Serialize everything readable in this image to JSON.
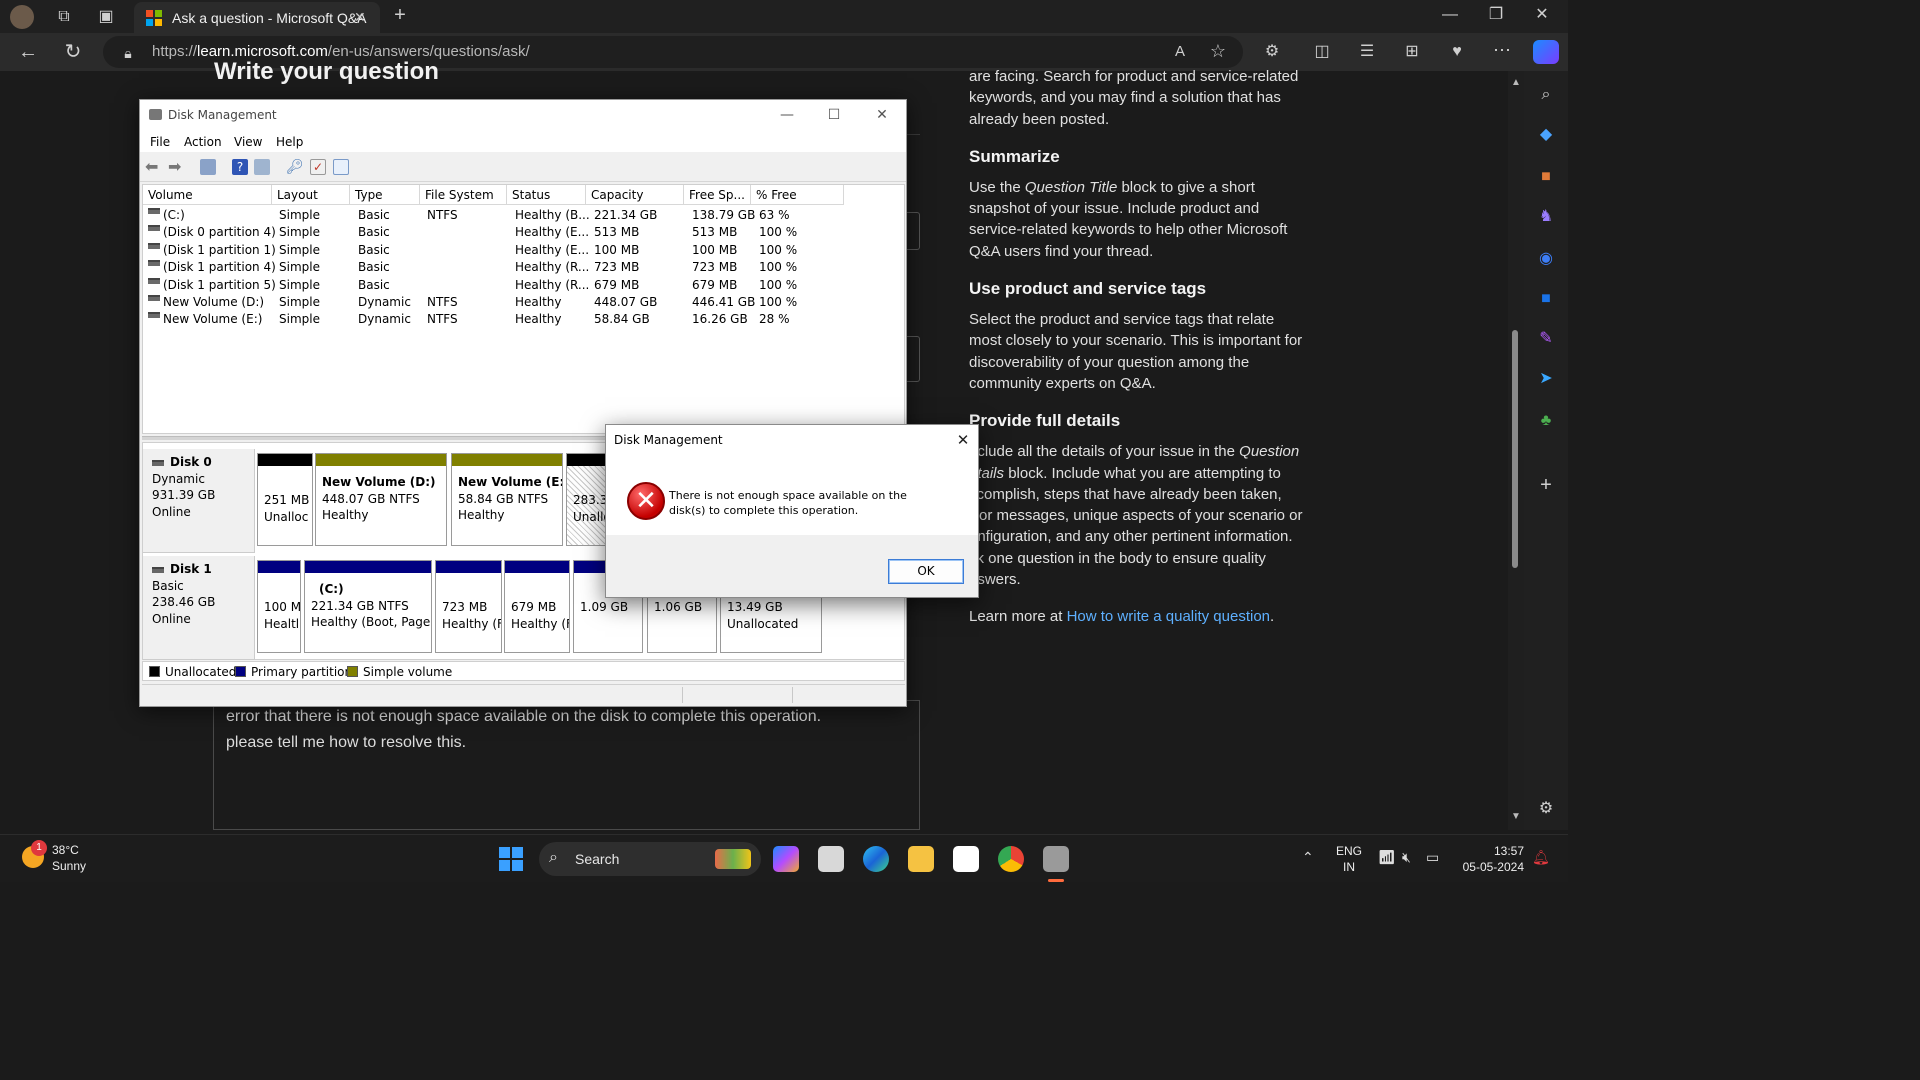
{
  "browser": {
    "tab_title": "Ask a question - Microsoft Q&A",
    "url_prefix": "https://",
    "url_domain": "learn.microsoft.com",
    "url_path": "/en-us/answers/questions/ask/"
  },
  "page": {
    "heading": "Write your question",
    "editor_text_line1": "error that there is not enough space available on the disk to complete this operation.",
    "editor_text_line2": "please tell me how to resolve this.",
    "guidance_intro": "are facing. Search for product and service-related keywords, and you may find a solution that has already been posted.",
    "summarize_heading": "Summarize",
    "summarize_pre": "Use the ",
    "summarize_em": "Question Title",
    "summarize_post": " block to give a short snapshot of your issue. Include product and service-related keywords to help other Microsoft Q&A users find your thread.",
    "tags_heading": "Use product and service tags",
    "tags_text": "Select the product and service tags that relate most closely to your scenario. This is important for discoverability of your question among the community experts on Q&A.",
    "details_heading": "Provide full details",
    "details_pre": "nclude all the details of your issue in the ",
    "details_em1": "Question",
    "details_em2": "etails",
    "details_post": " block. Include what you are attempting to ccomplish, steps that have already been taken, rror messages, unique aspects of your scenario or onfiguration, and any other pertinent information. sk one question in the body to ensure quality nswers.",
    "learn_more_pre": "Learn more at ",
    "learn_more_link": "How to write a quality question",
    "learn_more_post": "."
  },
  "disk_management": {
    "title": "Disk Management",
    "menu": [
      "File",
      "Action",
      "View",
      "Help"
    ],
    "columns": [
      "Volume",
      "Layout",
      "Type",
      "File System",
      "Status",
      "Capacity",
      "Free Sp...",
      "% Free"
    ],
    "rows": [
      [
        "(C:)",
        "Simple",
        "Basic",
        "NTFS",
        "Healthy (B...",
        "221.34 GB",
        "138.79 GB",
        "63 %"
      ],
      [
        "(Disk 0 partition 4)",
        "Simple",
        "Basic",
        "",
        "Healthy (E...",
        "513 MB",
        "513 MB",
        "100 %"
      ],
      [
        "(Disk 1 partition 1)",
        "Simple",
        "Basic",
        "",
        "Healthy (E...",
        "100 MB",
        "100 MB",
        "100 %"
      ],
      [
        "(Disk 1 partition 4)",
        "Simple",
        "Basic",
        "",
        "Healthy (R...",
        "723 MB",
        "723 MB",
        "100 %"
      ],
      [
        "(Disk 1 partition 5)",
        "Simple",
        "Basic",
        "",
        "Healthy (R...",
        "679 MB",
        "679 MB",
        "100 %"
      ],
      [
        "New Volume (D:)",
        "Simple",
        "Dynamic",
        "NTFS",
        "Healthy",
        "448.07 GB",
        "446.41 GB",
        "100 %"
      ],
      [
        "New Volume (E:)",
        "Simple",
        "Dynamic",
        "NTFS",
        "Healthy",
        "58.84 GB",
        "16.26 GB",
        "28 %"
      ]
    ],
    "disk0": {
      "name": "Disk 0",
      "type": "Dynamic",
      "size": "931.39 GB",
      "status": "Online",
      "p1_size": "251 MB",
      "p1_status": "Unalloc",
      "p2_name": "New Volume  (D:)",
      "p2_size": "448.07 GB NTFS",
      "p2_status": "Healthy",
      "p3_name": "New Volume  (E:)",
      "p3_size": "58.84 GB NTFS",
      "p3_status": "Healthy",
      "p4_size": "283.32",
      "p4_status": "Unallo"
    },
    "disk1": {
      "name": "Disk 1",
      "type": "Basic",
      "size": "238.46 GB",
      "status": "Online",
      "p1_size": "100 M",
      "p1_status": "Healtl",
      "p2_name": "(C:)",
      "p2_size": "221.34 GB NTFS",
      "p2_status": "Healthy (Boot, Page F",
      "p3_size": "723 MB",
      "p3_status": "Healthy (F",
      "p4_size": "679 MB",
      "p4_status": "Healthy (F",
      "p5_size": "1.09 GB",
      "p6_size": "1.06 GB",
      "p7_size": "13.49 GB",
      "p7_status": "Unallocated"
    },
    "legend": [
      "Unallocated",
      "Primary partition",
      "Simple volume"
    ],
    "colors": {
      "unallocated": "#000000",
      "primary": "#000080",
      "simple": "#808000"
    }
  },
  "error_dialog": {
    "title": "Disk Management",
    "message": "There is not enough space available on the disk(s) to complete this operation.",
    "ok_label": "OK",
    "close_glyph": "✕",
    "icon_glyph": "✕"
  },
  "taskbar": {
    "weather_badge": "1",
    "temperature": "38°C",
    "condition": "Sunny",
    "search_label": "Search",
    "lang_line1": "ENG",
    "lang_line2": "IN",
    "time": "13:57",
    "date": "05-05-2024"
  }
}
